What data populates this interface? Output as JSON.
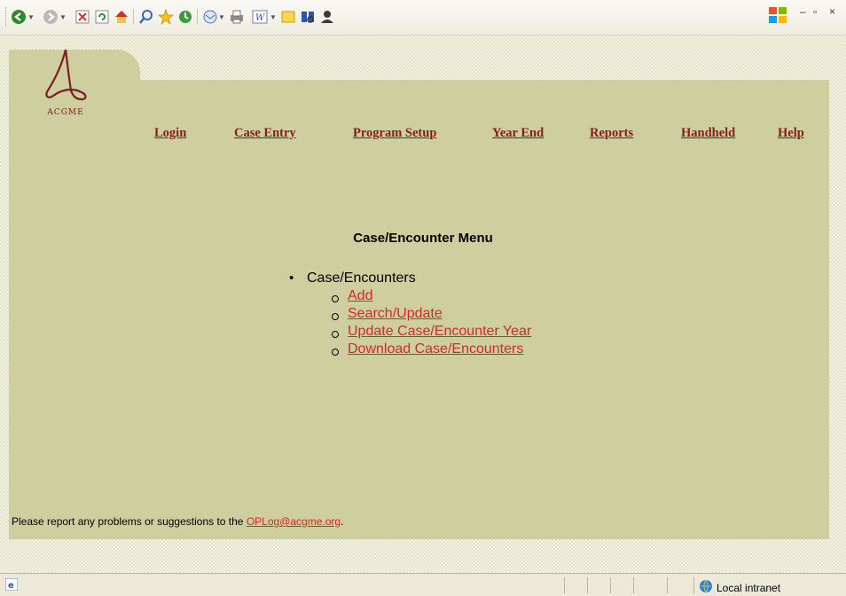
{
  "browser": {
    "toolbar_icons": [
      "back-icon",
      "forward-icon",
      "stop-icon",
      "refresh-icon",
      "home-icon",
      "search-icon",
      "favorites-icon",
      "history-icon",
      "mail-icon",
      "print-icon",
      "edit-icon",
      "discuss-icon",
      "research-icon",
      "messenger-icon"
    ],
    "status_zone": "Local intranet"
  },
  "logo": {
    "text": "ACGME",
    "color": "#7a1e28"
  },
  "nav": {
    "login": "Login",
    "case_entry": "Case Entry",
    "program_setup": "Program Setup",
    "year_end": "Year End",
    "reports": "Reports",
    "handheld": "Handheld",
    "help": "Help"
  },
  "menu": {
    "title": "Case/Encounter Menu",
    "section": "Case/Encounters",
    "items": [
      "Add",
      "Search/Update",
      "Update Case/Encounter Year",
      "Download Case/Encounters"
    ]
  },
  "footer": {
    "text": "Please report any problems or suggestions to the ",
    "email": "OPLog@acgme.org",
    "suffix": "."
  },
  "colors": {
    "panel": "#cece9e",
    "nav_link": "#8b1a1a",
    "link": "#d8262b"
  }
}
